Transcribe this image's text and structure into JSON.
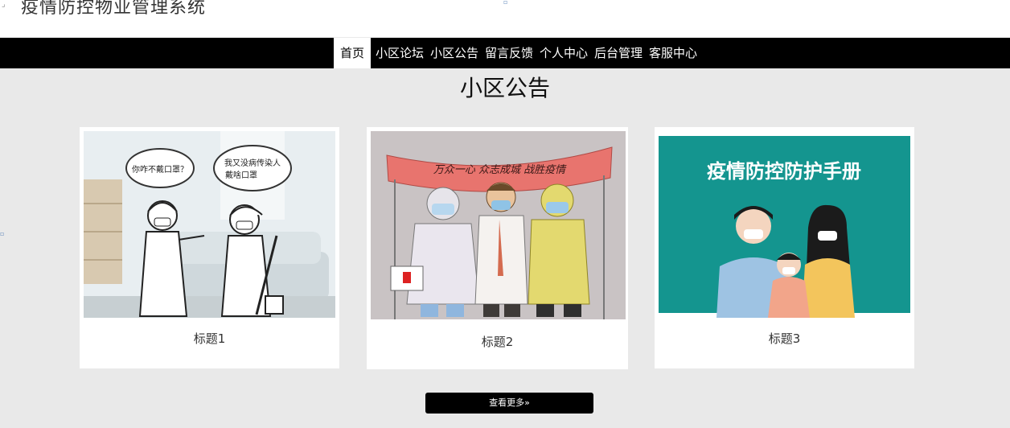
{
  "header": {
    "title": "疫情防控物业管理系统"
  },
  "nav": {
    "items": [
      {
        "label": "首页",
        "active": true
      },
      {
        "label": "小区论坛"
      },
      {
        "label": "小区公告"
      },
      {
        "label": "留言反馈"
      },
      {
        "label": "个人中心"
      },
      {
        "label": "后台管理"
      },
      {
        "label": "客服中心"
      }
    ]
  },
  "section": {
    "title": "小区公告"
  },
  "cards": [
    {
      "caption": "标题1",
      "image": {
        "bubble_left": "你咋不戴口罩？",
        "bubble_right_line1": "我又没病传染人",
        "bubble_right_line2": "戴啥口罩"
      }
    },
    {
      "caption": "标题2",
      "image": {
        "banner": "万众一心 众志成城 战胜疫情"
      }
    },
    {
      "caption": "标题3",
      "image": {
        "heading": "疫情防控防护手册"
      }
    }
  ],
  "more_button": {
    "label": "查看更多»"
  },
  "colors": {
    "nav_bg": "#000000",
    "page_bg": "#e9e9e9",
    "card_bg": "#ffffff",
    "teal": "#14958f"
  }
}
